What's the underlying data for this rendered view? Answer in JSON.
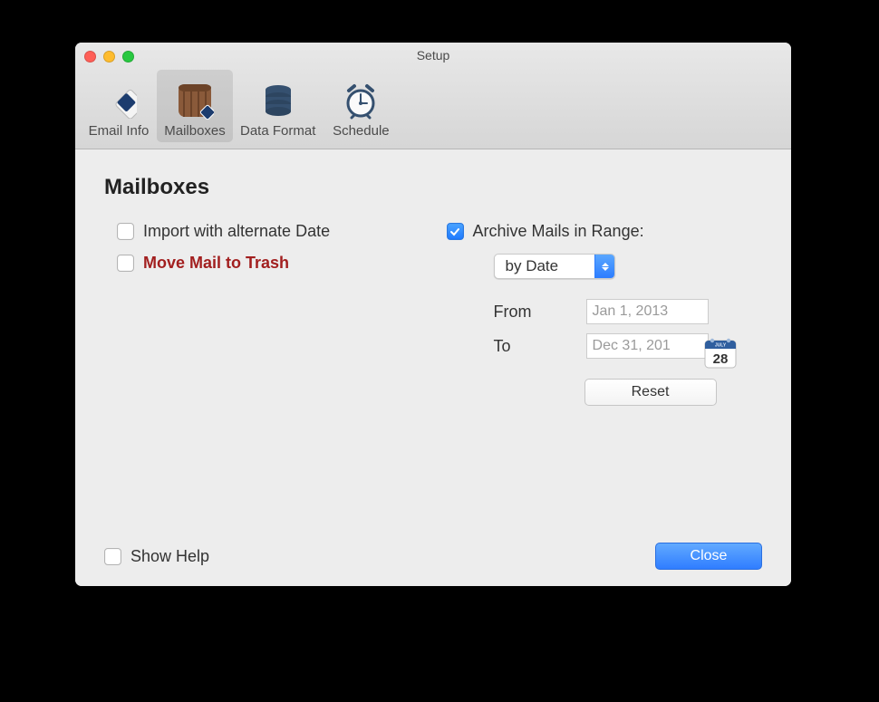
{
  "window": {
    "title": "Setup"
  },
  "toolbar": {
    "items": [
      {
        "label": "Email Info"
      },
      {
        "label": "Mailboxes"
      },
      {
        "label": "Data Format"
      },
      {
        "label": "Schedule"
      }
    ],
    "selected_index": 1
  },
  "section": {
    "title": "Mailboxes"
  },
  "left": {
    "import_alt_date": {
      "label": "Import with alternate Date",
      "checked": false
    },
    "move_trash": {
      "label": "Move Mail to Trash",
      "checked": false
    }
  },
  "right": {
    "archive_range": {
      "label": "Archive Mails in Range:",
      "checked": true
    },
    "mode_select": {
      "value": "by Date"
    },
    "from": {
      "label": "From",
      "value": "Jan 1, 2013"
    },
    "to": {
      "label": "To",
      "value": "Dec 31, 201"
    },
    "reset": "Reset",
    "calendar_badge": {
      "month": "JULY",
      "day": "28"
    }
  },
  "footer": {
    "show_help": {
      "label": "Show Help",
      "checked": false
    },
    "close": "Close"
  }
}
